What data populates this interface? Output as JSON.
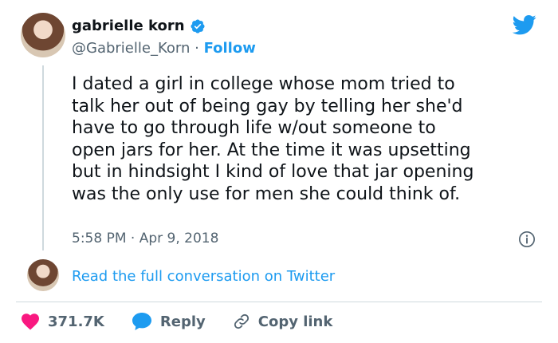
{
  "author": {
    "display_name": "gabrielle korn",
    "handle": "@Gabrielle_Korn",
    "separator": "·",
    "follow_label": "Follow"
  },
  "tweet": {
    "lines": [
      "I dated a girl in college whose mom tried to",
      "talk her out of being gay by telling her she'd",
      "have to go through life w/out someone to",
      "open jars for her. At the time it was upsetting",
      "but in hindsight I kind of love that jar opening",
      "was the only use for men she could think of."
    ],
    "timestamp": "5:58 PM · Apr 9, 2018"
  },
  "conversation": {
    "read_full_label": "Read the full conversation on Twitter"
  },
  "actions": {
    "likes_count": "371.7K",
    "reply_label": "Reply",
    "copy_link_label": "Copy link"
  },
  "colors": {
    "accent": "#1d9bf0",
    "like": "#f91880",
    "muted_text": "#536471",
    "main_text": "#0f1419"
  },
  "icons": [
    "verified-badge-icon",
    "twitter-bird-icon",
    "info-icon",
    "heart-icon",
    "reply-bubble-icon",
    "link-icon"
  ]
}
